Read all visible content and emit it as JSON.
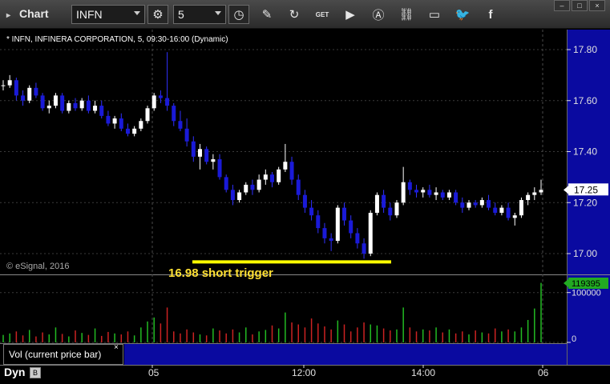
{
  "toolbar": {
    "title": "Chart",
    "symbol": "INFN",
    "interval": "5",
    "icons": [
      "settings-icon",
      "clock-icon",
      "pencil-icon",
      "refresh-icon",
      "get-icon",
      "play-icon",
      "alert-icon",
      "link-icon",
      "comment-icon",
      "twitter-icon",
      "facebook-icon"
    ],
    "get_label": "GET"
  },
  "window_buttons": [
    "–",
    "□",
    "×"
  ],
  "chart_header": "* INFN, INFINERA CORPORATION, 5, 09:30-16:00 (Dynamic)",
  "watermark": "© eSignal, 2016",
  "annotation": "16.98 short trigger",
  "price_axis": {
    "ticks": [
      "17.80",
      "17.60",
      "17.40",
      "17.20",
      "17.00"
    ],
    "last_price": "17.25"
  },
  "volume_axis": {
    "ticks": [
      "100000",
      "0"
    ],
    "last_volume": "119395"
  },
  "volume_study_label": "Vol (current price bar)",
  "close_symbol": "×",
  "time_axis": [
    "05",
    "12:00",
    "14:00",
    "06"
  ],
  "bottom": {
    "dyn_label": "Dyn",
    "dyn_button": "B"
  },
  "colors": {
    "up_candle": "#ffffff",
    "down_candle": "#1a1ad8",
    "annotation_line": "#ffff00",
    "annotation_text": "#ffe033",
    "axis_bg": "#0a0aa0",
    "last_price_bg": "#ffffff",
    "last_volume_bg": "#22aa22",
    "vol_up": "#22bb22",
    "vol_down": "#cc2222"
  },
  "chart_data": {
    "type": "candlestick",
    "ylim": [
      16.95,
      17.85
    ],
    "annotation_level": 16.98,
    "candles": [
      [
        17.66,
        17.68,
        17.64,
        17.66
      ],
      [
        17.66,
        17.7,
        17.65,
        17.68
      ],
      [
        17.68,
        17.69,
        17.6,
        17.62
      ],
      [
        17.62,
        17.64,
        17.58,
        17.6
      ],
      [
        17.6,
        17.66,
        17.59,
        17.65
      ],
      [
        17.65,
        17.67,
        17.61,
        17.62
      ],
      [
        17.62,
        17.63,
        17.56,
        17.57
      ],
      [
        17.57,
        17.6,
        17.55,
        17.58
      ],
      [
        17.58,
        17.63,
        17.57,
        17.62
      ],
      [
        17.62,
        17.63,
        17.55,
        17.56
      ],
      [
        17.56,
        17.6,
        17.55,
        17.59
      ],
      [
        17.59,
        17.61,
        17.56,
        17.57
      ],
      [
        17.57,
        17.61,
        17.56,
        17.6
      ],
      [
        17.6,
        17.62,
        17.55,
        17.56
      ],
      [
        17.56,
        17.6,
        17.55,
        17.58
      ],
      [
        17.58,
        17.6,
        17.53,
        17.54
      ],
      [
        17.54,
        17.56,
        17.5,
        17.51
      ],
      [
        17.51,
        17.54,
        17.49,
        17.53
      ],
      [
        17.53,
        17.55,
        17.48,
        17.49
      ],
      [
        17.49,
        17.51,
        17.46,
        17.47
      ],
      [
        17.47,
        17.5,
        17.46,
        17.49
      ],
      [
        17.49,
        17.53,
        17.48,
        17.52
      ],
      [
        17.52,
        17.58,
        17.51,
        17.57
      ],
      [
        17.57,
        17.63,
        17.56,
        17.62
      ],
      [
        17.62,
        17.64,
        17.59,
        17.61
      ],
      [
        17.61,
        17.79,
        17.56,
        17.58
      ],
      [
        17.58,
        17.59,
        17.5,
        17.52
      ],
      [
        17.52,
        17.56,
        17.48,
        17.49
      ],
      [
        17.49,
        17.53,
        17.42,
        17.44
      ],
      [
        17.44,
        17.46,
        17.36,
        17.38
      ],
      [
        17.38,
        17.43,
        17.33,
        17.41
      ],
      [
        17.41,
        17.42,
        17.35,
        17.36
      ],
      [
        17.36,
        17.39,
        17.33,
        17.37
      ],
      [
        17.37,
        17.39,
        17.29,
        17.3
      ],
      [
        17.3,
        17.31,
        17.24,
        17.25
      ],
      [
        17.25,
        17.27,
        17.19,
        17.21
      ],
      [
        17.21,
        17.25,
        17.2,
        17.24
      ],
      [
        17.24,
        17.28,
        17.23,
        17.27
      ],
      [
        17.27,
        17.29,
        17.23,
        17.25
      ],
      [
        17.25,
        17.31,
        17.24,
        17.29
      ],
      [
        17.29,
        17.33,
        17.27,
        17.31
      ],
      [
        17.31,
        17.32,
        17.26,
        17.28
      ],
      [
        17.28,
        17.34,
        17.27,
        17.33
      ],
      [
        17.33,
        17.43,
        17.32,
        17.36
      ],
      [
        17.36,
        17.38,
        17.27,
        17.29
      ],
      [
        17.29,
        17.31,
        17.21,
        17.23
      ],
      [
        17.23,
        17.25,
        17.16,
        17.18
      ],
      [
        17.18,
        17.21,
        17.13,
        17.15
      ],
      [
        17.15,
        17.17,
        17.08,
        17.1
      ],
      [
        17.1,
        17.12,
        17.04,
        17.06
      ],
      [
        17.06,
        17.08,
        17.01,
        17.05
      ],
      [
        17.05,
        17.19,
        17.04,
        17.18
      ],
      [
        17.18,
        17.2,
        17.11,
        17.13
      ],
      [
        17.13,
        17.15,
        17.06,
        17.08
      ],
      [
        17.08,
        17.1,
        17.02,
        17.04
      ],
      [
        17.04,
        17.06,
        16.98,
        17.0
      ],
      [
        17.0,
        17.17,
        16.99,
        17.16
      ],
      [
        17.16,
        17.24,
        17.15,
        17.23
      ],
      [
        17.23,
        17.25,
        17.16,
        17.18
      ],
      [
        17.18,
        17.2,
        17.13,
        17.15
      ],
      [
        17.15,
        17.21,
        17.14,
        17.2
      ],
      [
        17.2,
        17.34,
        17.19,
        17.28
      ],
      [
        17.28,
        17.29,
        17.23,
        17.25
      ],
      [
        17.25,
        17.27,
        17.22,
        17.24
      ],
      [
        17.24,
        17.26,
        17.22,
        17.25
      ],
      [
        17.25,
        17.27,
        17.22,
        17.23
      ],
      [
        17.23,
        17.26,
        17.21,
        17.24
      ],
      [
        17.24,
        17.25,
        17.21,
        17.22
      ],
      [
        17.22,
        17.25,
        17.21,
        17.24
      ],
      [
        17.24,
        17.25,
        17.19,
        17.2
      ],
      [
        17.2,
        17.22,
        17.16,
        17.18
      ],
      [
        17.18,
        17.21,
        17.17,
        17.2
      ],
      [
        17.2,
        17.21,
        17.18,
        17.19
      ],
      [
        17.19,
        17.22,
        17.18,
        17.21
      ],
      [
        17.21,
        17.23,
        17.17,
        17.18
      ],
      [
        17.18,
        17.2,
        17.15,
        17.16
      ],
      [
        17.16,
        17.19,
        17.15,
        17.18
      ],
      [
        17.18,
        17.2,
        17.13,
        17.14
      ],
      [
        17.14,
        17.16,
        17.11,
        17.15
      ],
      [
        17.15,
        17.22,
        17.14,
        17.21
      ],
      [
        17.21,
        17.24,
        17.19,
        17.23
      ],
      [
        17.23,
        17.26,
        17.21,
        17.24
      ],
      [
        17.24,
        17.29,
        17.23,
        17.25
      ]
    ],
    "volume_ylim": [
      0,
      130000
    ],
    "volumes": [
      15000,
      18000,
      22000,
      14000,
      25000,
      12000,
      20000,
      16000,
      30000,
      17000,
      12000,
      24000,
      19000,
      15000,
      28000,
      13000,
      21000,
      18000,
      16000,
      22000,
      14000,
      30000,
      42000,
      50000,
      38000,
      70000,
      22000,
      18000,
      26000,
      20000,
      16000,
      14000,
      28000,
      24000,
      18000,
      26000,
      20000,
      30000,
      16000,
      22000,
      25000,
      34000,
      28000,
      60000,
      40000,
      36000,
      30000,
      48000,
      38000,
      32000,
      26000,
      44000,
      36000,
      22000,
      30000,
      40000,
      36000,
      34000,
      28000,
      24000,
      26000,
      70000,
      30000,
      22000,
      26000,
      24000,
      30000,
      20000,
      26000,
      18000,
      22000,
      16000,
      24000,
      20000,
      18000,
      28000,
      22000,
      26000,
      22000,
      30000,
      45000,
      68000,
      119395
    ]
  }
}
